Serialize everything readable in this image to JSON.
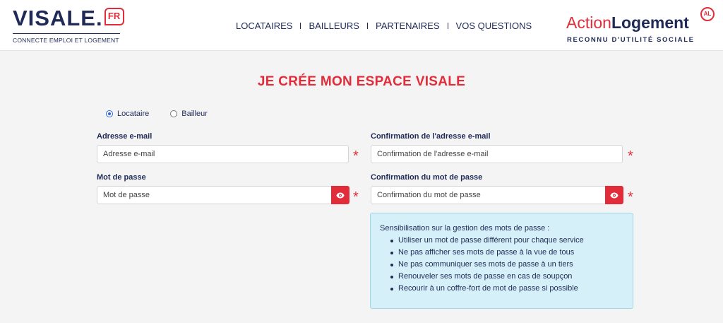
{
  "header": {
    "logo_text": "VISALE.",
    "logo_badge": "FR",
    "tagline": "CONNECTE EMPLOI ET LOGEMENT",
    "nav": [
      "LOCATAIRES",
      "BAILLEURS",
      "PARTENAIRES",
      "VOS QUESTIONS"
    ],
    "partner_logo": {
      "action": "Action",
      "logement": "Logement",
      "badge": "AL",
      "subtitle": "RECONNU D'UTILITÉ SOCIALE"
    }
  },
  "form": {
    "title": "JE CRÉE MON ESPACE VISALE",
    "role_options": [
      {
        "label": "Locataire",
        "selected": true
      },
      {
        "label": "Bailleur",
        "selected": false
      }
    ],
    "email": {
      "label": "Adresse e-mail",
      "placeholder": "Adresse e-mail",
      "value": ""
    },
    "email_confirm": {
      "label": "Confirmation de l'adresse e-mail",
      "placeholder": "Confirmation de l'adresse e-mail",
      "value": ""
    },
    "password": {
      "label": "Mot de passe",
      "placeholder": "Mot de passe",
      "value": ""
    },
    "password_confirm": {
      "label": "Confirmation du mot de passe",
      "placeholder": "Confirmation du mot de passe",
      "value": ""
    },
    "required_mark": "*"
  },
  "info": {
    "title": "Sensibilisation sur la gestion des mots de passe :",
    "items": [
      "Utiliser un mot de passe différent pour chaque service",
      "Ne pas afficher ses mots de passe à la vue de tous",
      "Ne pas communiquer ses mots de passe à un tiers",
      "Renouveler ses mots de passe en cas de soupçon",
      "Recourir à un coffre-fort de mot de passe si possible"
    ]
  },
  "icons": {
    "show_password": "eye-icon",
    "brand_red": "#e12d39",
    "brand_navy": "#1f2a56",
    "info_bg": "#d5f0f8"
  }
}
